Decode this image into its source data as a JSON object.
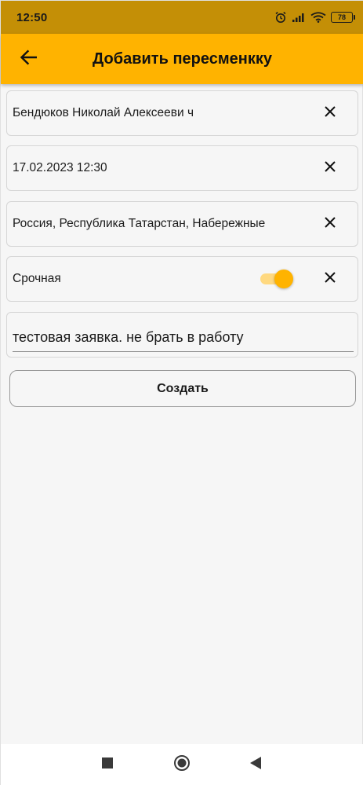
{
  "status_bar": {
    "time": "12:50",
    "battery": "78",
    "icons": [
      "alarm-icon",
      "signal-icon",
      "wifi-icon",
      "battery-icon"
    ]
  },
  "app_bar": {
    "title": "Добавить пересменкку",
    "back_icon": "arrow-left-icon",
    "color": "#ffb300"
  },
  "form": {
    "employee": "Бендюков Николай Алексееви ч",
    "datetime": "17.02.2023 12:30",
    "address": "Россия, Республика Татарстан, Набережные",
    "urgent_label": "Срочная",
    "urgent_on": true,
    "comment": "тестовая заявка. не брать в работу",
    "clear_icon": "close-icon"
  },
  "actions": {
    "create_label": "Создать"
  },
  "nav_bar": {
    "icons": [
      "square-icon",
      "circle-icon",
      "back-triangle-icon"
    ]
  },
  "colors": {
    "accent": "#ffb300",
    "status_bar": "#c48f06",
    "background": "#f6f6f6"
  }
}
